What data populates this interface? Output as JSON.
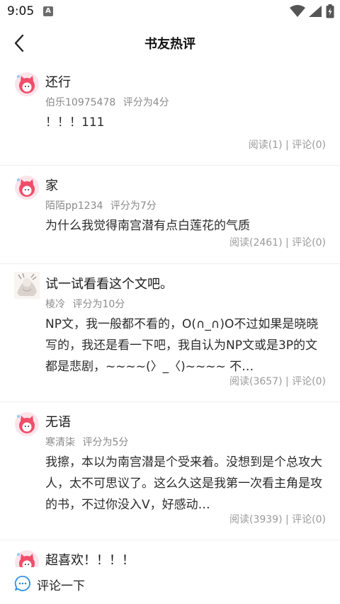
{
  "status_bar": {
    "time": "9:05",
    "indicator": "A"
  },
  "header": {
    "title": "书友热评"
  },
  "reviews": [
    {
      "title": "还行",
      "user": "伯乐10975478",
      "rating": "评分为4分",
      "body": "！！！111",
      "stats": "阅读(1) | 评论(0)",
      "avatar": "pink-cat-avatar"
    },
    {
      "title": "家",
      "user": "陌陌pp1234",
      "rating": "评分为7分",
      "body": "为什么我觉得南宫潜有点白莲花的气质",
      "stats": "阅读(2461) | 评论(0)",
      "avatar": "pink-cat-avatar"
    },
    {
      "title": "试一试看看这个文吧。",
      "user": "棱冷",
      "rating": "评分为10分",
      "body": "NP文，我一般都不看的，O(∩_∩)O不过如果是晓晓写的，我还是看一下吧，我自认为NP文或是3P的文都是悲剧，~~~~(〉_〈)~~~~ 不…",
      "stats": "阅读(3657) | 评论(0)",
      "avatar": "sketch-avatar"
    },
    {
      "title": "无语",
      "user": "寒清柒",
      "rating": "评分为5分",
      "body": "我擦，本以为南宫潜是个受来着。没想到是个总攻大人，太不可思议了。这么久这是我第一次看主角是攻的书，不过你没入V，好感动…",
      "stats": "阅读(3939) | 评论(0)",
      "avatar": "pink-cat-avatar"
    },
    {
      "title": "超喜欢！！！！",
      "user": "",
      "rating": "",
      "body": "",
      "stats": "",
      "avatar": "pink-cat-avatar"
    }
  ],
  "footer": {
    "comment_label": "评论一下"
  },
  "colors": {
    "accent": "#2f8fe0",
    "avatar_pink": "#f04d6a",
    "text_meta": "#8a8a8a"
  }
}
